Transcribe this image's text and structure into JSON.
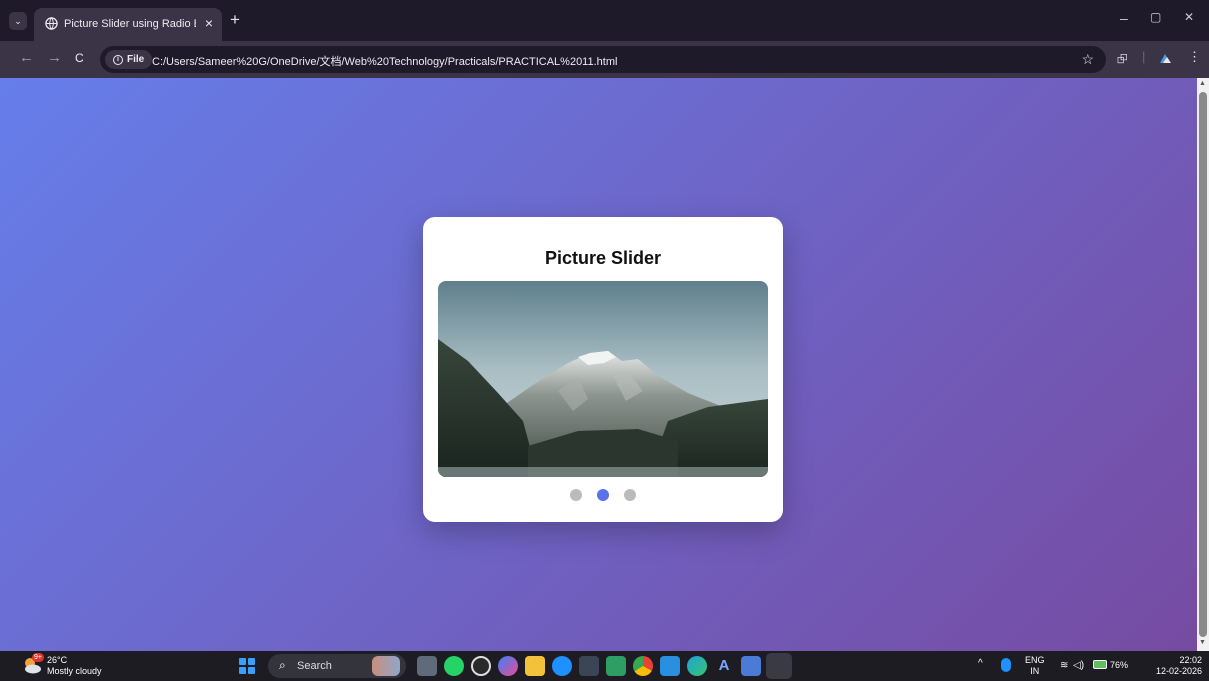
{
  "browser": {
    "tab": {
      "title": "Picture Slider using Radio Butto",
      "close": "×"
    },
    "new_tab": "+",
    "window": {
      "minimize": "–",
      "maximize": "▢",
      "close": "✕"
    },
    "nav": {
      "back": "←",
      "forward": "→",
      "reload": "C"
    },
    "address": {
      "chip_label": "File",
      "url": "C:/Users/Sameer%20G/OneDrive/文档/Web%20Technology/Practicals/PRACTICAL%2011.html"
    },
    "icons": {
      "bookmark": "☆",
      "extensions": "⮺",
      "menu": "⋮"
    }
  },
  "page": {
    "card_title": "Picture Slider",
    "slides": 3,
    "active_slide": 2,
    "slide_image": "mountain-landscape",
    "colors": {
      "bg_start": "#667eea",
      "bg_end": "#764ba2",
      "dot_active": "#5b73e8",
      "dot_inactive": "#bbbbbb"
    }
  },
  "taskbar": {
    "weather": {
      "temp": "26°C",
      "condition": "Mostly cloudy",
      "badge": "9+"
    },
    "search_placeholder": "Search",
    "tray": {
      "lang_top": "ENG",
      "lang_bottom": "IN",
      "battery": "76%",
      "time": "22:02",
      "date": "12-02-2026"
    }
  }
}
